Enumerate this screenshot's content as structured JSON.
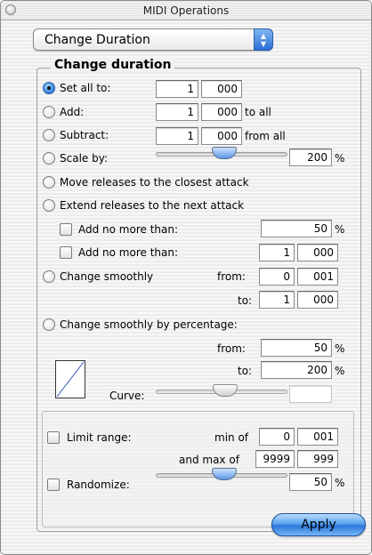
{
  "window": {
    "title": "MIDI Operations"
  },
  "operation_popup": {
    "selected": "Change Duration"
  },
  "group_title": "Change duration",
  "set_all": {
    "label": "Set all to:",
    "value1": "1",
    "value2": "000"
  },
  "add": {
    "label": "Add:",
    "value1": "1",
    "value2": "000",
    "suffix": "to all"
  },
  "subtract": {
    "label": "Subtract:",
    "value1": "1",
    "value2": "000",
    "suffix": "from all"
  },
  "scale": {
    "label": "Scale by:",
    "value": "200",
    "unit": "%",
    "slider_level_pct": 50
  },
  "move_releases": {
    "label": "Move releases to the closest attack"
  },
  "extend_releases": {
    "label": "Extend releases to the next attack"
  },
  "add_no_more_pct": {
    "label": "Add no more than:",
    "value": "50",
    "unit": "%"
  },
  "add_no_more_time": {
    "label": "Add no more than:",
    "value1": "1",
    "value2": "000"
  },
  "change_smoothly": {
    "label": "Change smoothly",
    "from_label": "from:",
    "from1": "0",
    "from2": "001",
    "to_label": "to:",
    "to1": "1",
    "to2": "000"
  },
  "change_smoothly_pct": {
    "label": "Change smoothly by percentage:",
    "from_label": "from:",
    "from_value": "50",
    "from_unit": "%",
    "to_label": "to:",
    "to_value": "200",
    "to_unit": "%"
  },
  "curve": {
    "label": "Curve:"
  },
  "limit_range": {
    "label": "Limit range:",
    "min_label": "min of",
    "min1": "0",
    "min2": "001",
    "max_label": "and max of",
    "max1": "9999",
    "max2": "999"
  },
  "randomize": {
    "label": "Randomize:",
    "value": "50",
    "unit": "%"
  },
  "apply_button": {
    "label": "Apply"
  },
  "colors": {
    "accent": "#3d8ee6",
    "button": "#2b76d9"
  }
}
